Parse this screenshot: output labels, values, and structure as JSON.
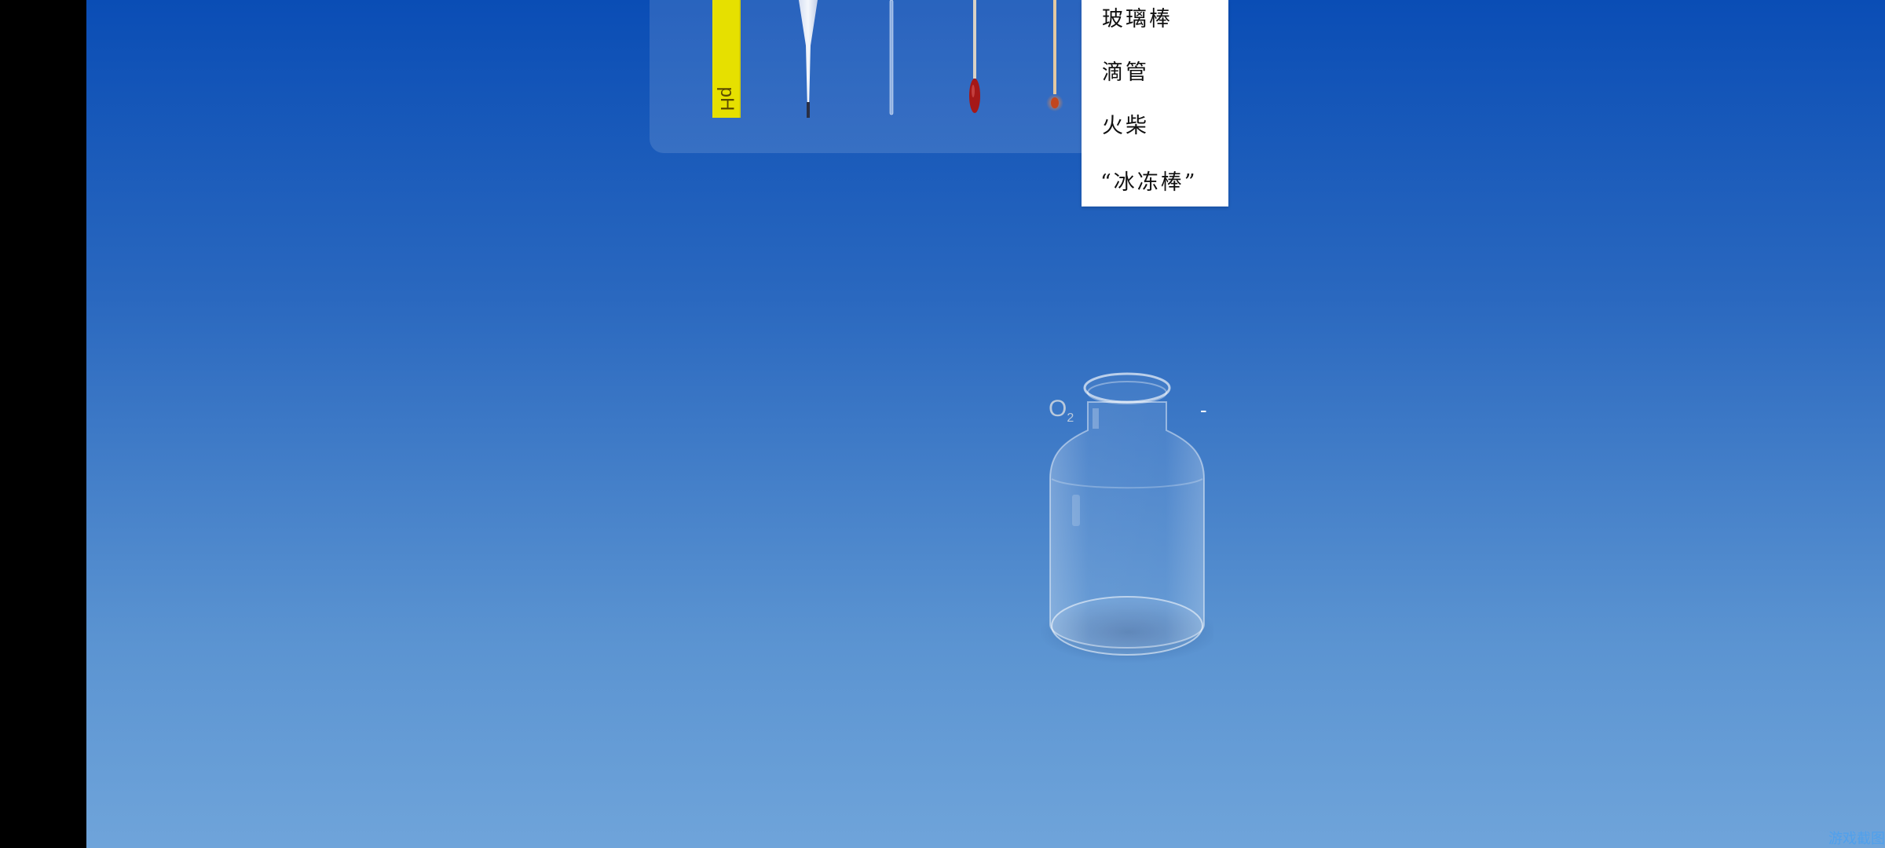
{
  "tools": {
    "ph_strip_label": "pH"
  },
  "menu": {
    "items": [
      {
        "label": "玻璃棒"
      },
      {
        "label": "滴管"
      },
      {
        "label": "火柴"
      },
      {
        "label": "“冰冻棒”"
      }
    ]
  },
  "bottle": {
    "gas_label": "O",
    "gas_subscript": "2",
    "indicator": "-"
  },
  "colors": {
    "background_top": "#0a4db5",
    "background_bottom": "#6fa4da",
    "ph_strip": "#e6e000",
    "swab_tip": "#b52222"
  },
  "watermark": "游戏截图"
}
